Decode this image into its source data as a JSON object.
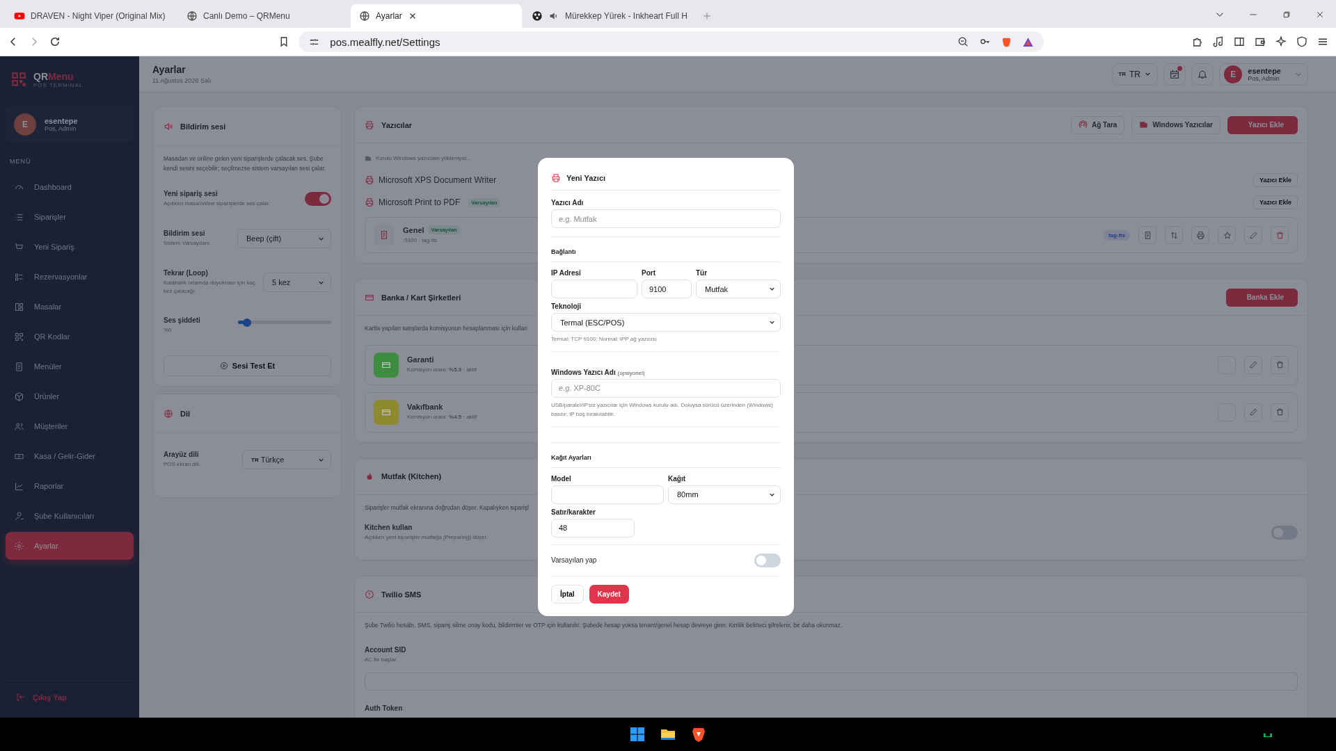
{
  "browser": {
    "tabs": [
      {
        "title": "DRAVEN - Night Viper (Original Mix)",
        "selected": false,
        "kind": "video"
      },
      {
        "title": "Canlı Demo – QRMenu",
        "selected": false,
        "kind": "site"
      },
      {
        "title": "Ayarlar",
        "selected": true,
        "kind": "site"
      },
      {
        "title": "Mürekkep Yürek - Inkheart Full H",
        "selected": false,
        "kind": "media"
      }
    ],
    "url": "pos.mealfly.net/Settings"
  },
  "sidebar": {
    "brand": "QR",
    "brand_accent": "Menu",
    "subtitle": "POS TERMINAL",
    "user": {
      "initial": "E",
      "name": "esentepe",
      "role": "Pos, Admin"
    },
    "section": "MENÜ",
    "items": [
      {
        "label": "Dashboard",
        "selected": false
      },
      {
        "label": "Siparişler",
        "selected": false
      },
      {
        "label": "Yeni Sipariş",
        "selected": false
      },
      {
        "label": "Rezervasyonlar",
        "selected": false
      },
      {
        "label": "Masalar",
        "selected": false
      },
      {
        "label": "QR Kodlar",
        "selected": false
      },
      {
        "label": "Menüler",
        "selected": false
      },
      {
        "label": "Ürünler",
        "selected": false
      },
      {
        "label": "Müşteriler",
        "selected": false
      },
      {
        "label": "Kasa / Gelir-Gider",
        "selected": false
      },
      {
        "label": "Raporlar",
        "selected": false
      },
      {
        "label": "Şube Kullanıcıları",
        "selected": false
      },
      {
        "label": "Ayarlar",
        "selected": true
      }
    ],
    "logout": "Çıkış Yap"
  },
  "header": {
    "title": "Ayarlar",
    "date": "11 Ağustos 2026 Salı",
    "lang_flag": "TR",
    "lang": "TR",
    "user": {
      "initial": "E",
      "name": "esentepe",
      "role": "Pos, Admin"
    }
  },
  "sound": {
    "title": "Bildirim sesi",
    "description": "Masadan ve online gelen yeni siparişlerde çalacak ses. Şube kendi sesini seçebilir; seçilmezse sistem varsayılan sesi çalar.",
    "toggle": {
      "label": "Yeni sipariş sesi",
      "hint": "Açıkken masa/online siparişlerde ses çalar.",
      "on": true
    },
    "sound_select": {
      "label": "Bildirim sesi",
      "hint": "Sistem Varsayılanı",
      "value": "Beep (çift)"
    },
    "loop": {
      "label": "Tekrar (Loop)",
      "hint": "Kalabalık ortamda duyulması için kaç kez çalacağı.",
      "value": "5 kez"
    },
    "volume": {
      "label": "Ses şiddeti",
      "reading": "%0",
      "level": 0.1
    },
    "test_button": "Sesi Test Et"
  },
  "language": {
    "title": "Dil",
    "label": "Arayüz dili",
    "hint": "POS ekran dili.",
    "flag": "TR",
    "value": "Türkçe"
  },
  "printers": {
    "title": "Yazıcılar",
    "scan_button": "Ağ Tara",
    "windows_button": "Windows Yazıcılar",
    "add_button": "Yazıcı Ekle",
    "loading": "Kurulu Windows yazıcıları yükleniyor...",
    "windows_printers": [
      {
        "name": "Microsoft XPS Document Writer",
        "action": "Yazıcı Ekle"
      },
      {
        "name": "Microsoft Print to PDF",
        "badge": "Varsayılan",
        "action": "Yazıcı Ekle"
      }
    ],
    "configured": [
      {
        "name": "Genel",
        "badge": "Varsayılan",
        "detail": ":9100 · tag-fis",
        "tag": "tag-fis"
      }
    ]
  },
  "banks": {
    "title": "Banka / Kart Şirketleri",
    "add_button": "Banka Ekle",
    "description": "Kartla yapılan satışlarda komisyonun hesaplanması için kullan",
    "items": [
      {
        "name": "Garanti",
        "info": "Komisyon oranı: **%5.3** · aktif",
        "color": "#3d8c40"
      },
      {
        "name": "Vakıfbank",
        "info": "Komisyon oranı: **%4.5** · aktif",
        "color": "#8c8a2c"
      }
    ]
  },
  "kitchen": {
    "title": "Mutfak (Kitchen)",
    "description": "Siparişler mutfak ekranına doğrudan düşer. Kapalıyken siparişl",
    "toggle": {
      "label": "Kitchen kullan",
      "hint": "Açıkken yeni siparişler mutfağa (Preparing) düşer.",
      "on": false
    }
  },
  "twilio": {
    "title": "Twilio SMS",
    "description": "Şube Twilio hesabı. SMS, sipariş silme onay kodu, bildirimler ve OTP için kullanılır. Şubede hesap yoksa tenant/genel hesap devreye girer. Kimlik belirteci şifrelenir, bir daha okunmaz.",
    "fields": [
      {
        "label": "Account SID",
        "hint": "AC ile başlar."
      },
      {
        "label": "Auth Token"
      }
    ]
  },
  "modal": {
    "title": "Yeni Yazıcı",
    "name_label": "Yazıcı Adı",
    "name_placeholder": "e.g. Mutfak",
    "connection": "Bağlantı",
    "ip_label": "IP Adresi",
    "port_label": "Port",
    "port": "9100",
    "type_label": "Tür",
    "type": "Mutfak",
    "tech_label": "Teknoloji",
    "tech": "Termal (ESC/POS)",
    "tech_hint": "Termal: TCP 9100; Normal: IPP ağ yazıcısı",
    "win_label": "Windows Yazıcı Adı",
    "win_optional": "(opsiyonel)",
    "win_placeholder": "e.g. XP-80C",
    "win_hint": "USB/paralel/IP'siz yazıcılar için Windows kurulu adı. Doluysa sürücü üzerinden (Windows) basılır; IP boş bırakılabilir.",
    "paper_section": "Kağıt Ayarları",
    "model_label": "Model",
    "paper_label": "Kağıt",
    "paper": "80mm",
    "chars_label": "Satır/karakter",
    "chars": "48",
    "default_label": "Varsayılan yap",
    "default_on": false,
    "cancel": "İptal",
    "save": "Kaydet"
  }
}
